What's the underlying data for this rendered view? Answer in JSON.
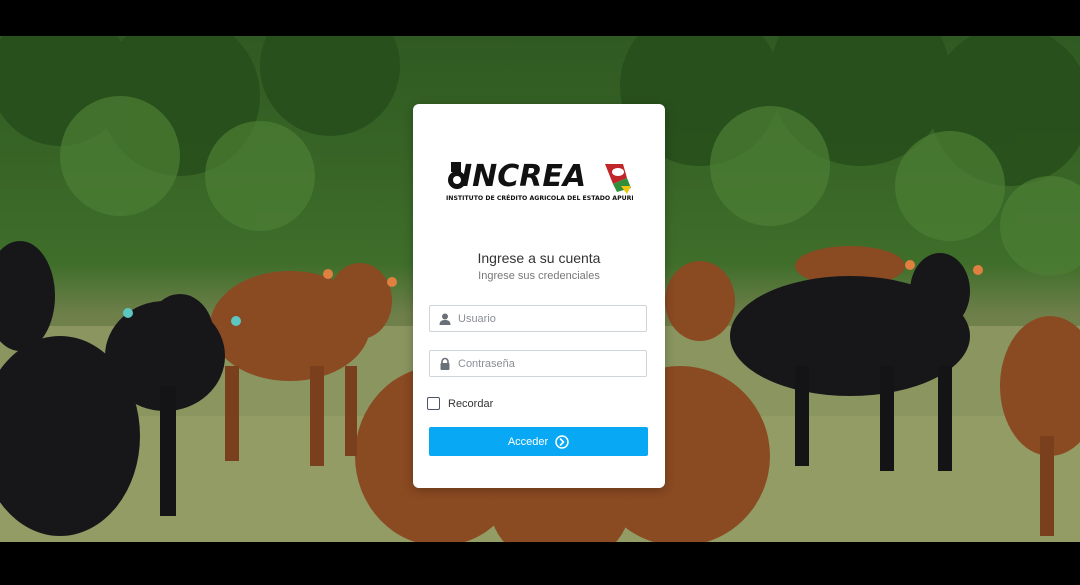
{
  "logo": {
    "wordmark": "INCREA",
    "tagline": "INSTITUTO DE CRÉDITO AGRICOLA DEL ESTADO APURE"
  },
  "login": {
    "title": "Ingrese a su cuenta",
    "subtitle": "Ingrese sus credenciales",
    "username_placeholder": "Usuario",
    "password_placeholder": "Contraseña",
    "remember_label": "Recordar",
    "submit_label": "Acceder"
  },
  "icons": {
    "username": "user-icon",
    "password": "lock-icon",
    "submit": "arrow-circle-right-icon"
  },
  "colors": {
    "accent": "#08a8f4",
    "card": "#ffffff",
    "page_frame": "#000000"
  },
  "remember_checked": false
}
